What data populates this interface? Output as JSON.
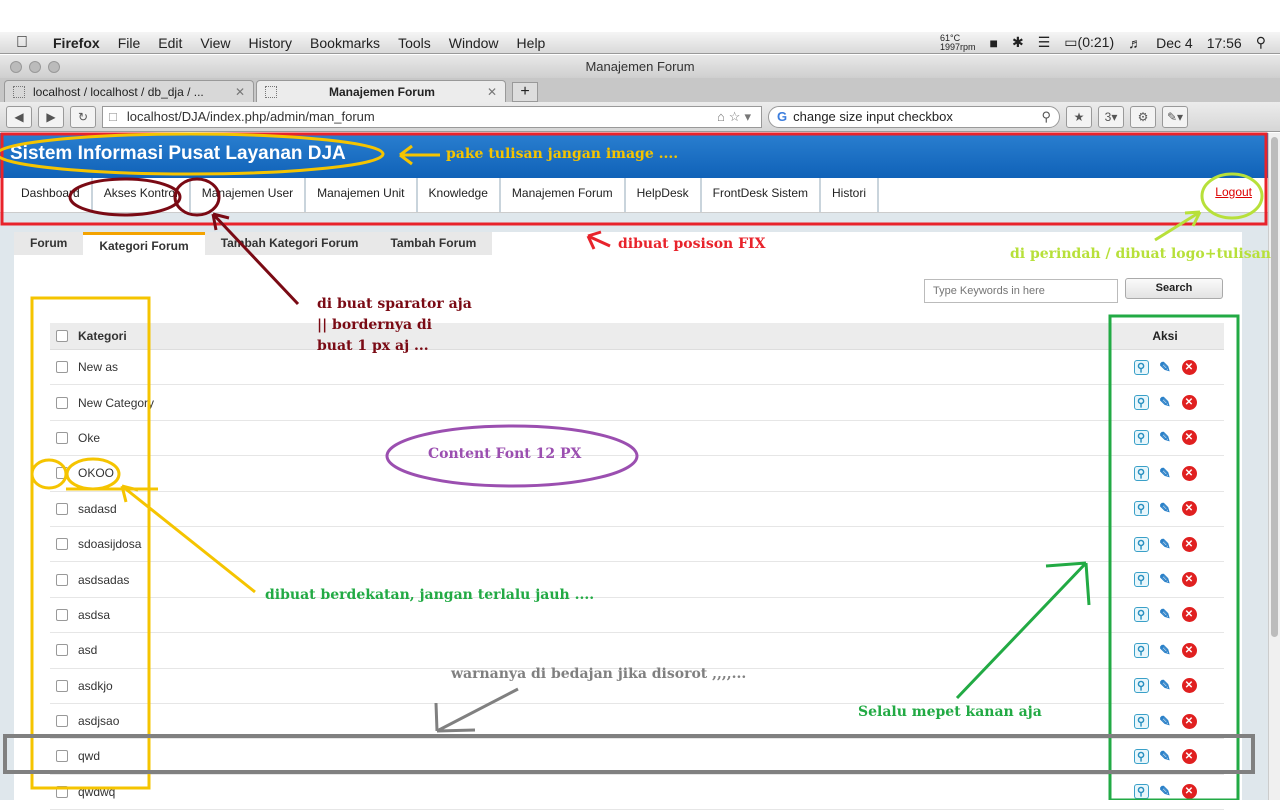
{
  "os_menu": {
    "app": "Firefox",
    "items": [
      "File",
      "Edit",
      "View",
      "History",
      "Bookmarks",
      "Tools",
      "Window",
      "Help"
    ],
    "temp": "61°C",
    "rpm": "1997rpm",
    "battery": "(0:21)",
    "date": "Dec 4",
    "time": "17:56"
  },
  "window": {
    "title": "Manajemen Forum"
  },
  "tabs": [
    {
      "label": "localhost / localhost / db_dja / ..."
    },
    {
      "label": "Manajemen Forum"
    }
  ],
  "navbar": {
    "url": "localhost/DJA/index.php/admin/man_forum",
    "search_value": "change size input checkbox",
    "addon_badge": "3"
  },
  "site": {
    "title": "Sistem Informasi Pusat Layanan DJA",
    "menu": [
      "Dashboard",
      "Akses Kontrol",
      "Manajemen User",
      "Manajemen Unit",
      "Knowledge",
      "Manajemen Forum",
      "HelpDesk",
      "FrontDesk Sistem",
      "Histori"
    ],
    "logout": "Logout"
  },
  "subtabs": [
    "Forum",
    "Kategori Forum",
    "Tambah Kategori Forum",
    "Tambah Forum"
  ],
  "search": {
    "placeholder": "Type Keywords in here",
    "button": "Search"
  },
  "table": {
    "headers": {
      "name": "Kategori",
      "actions": "Aksi"
    },
    "rows": [
      "New as",
      "New Category",
      "Oke",
      "OKOO",
      "sadasd",
      "sdoasijdosa",
      "asdsadas",
      "asdsa",
      "asd",
      "asdkjo",
      "asdjsao",
      "qwd",
      "qwdwq"
    ]
  },
  "annotations": {
    "title_note": "pake tulisan jangan image ....",
    "fixed_note": "dibuat posison FIX",
    "logout_note": "di perindah / dibuat logo+tulisan",
    "separator_note_1": "di buat sparator aja",
    "separator_note_2": "|| bordernya di",
    "separator_note_3": "buat 1 px aj ...",
    "font_note": "Content Font 12 PX",
    "checkbox_note": "dibuat berdekatan, jangan terlalu jauh ....",
    "hover_note": "warnanya di bedajan jika disorot ,,,,...",
    "right_note": "Selalu mepet kanan aja"
  },
  "colors": {
    "header_blue": "#1a6fc4",
    "annotation_red": "#e8232b",
    "annotation_yellow": "#f5c400",
    "annotation_green": "#22aa44",
    "annotation_purple": "#9b4fb0",
    "annotation_maroon": "#7a0a14",
    "annotation_gray": "#808080"
  }
}
